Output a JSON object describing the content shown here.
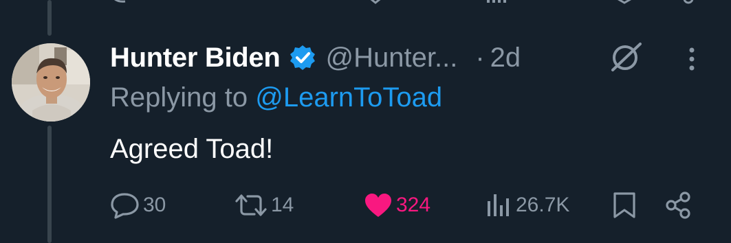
{
  "tweet": {
    "author_name": "Hunter Biden",
    "author_handle": "@Hunter...",
    "separator": "·",
    "timestamp": "2d",
    "replying_prefix": "Replying to",
    "replying_to": "@LearnToToad",
    "text": "Agreed Toad!"
  },
  "actions": {
    "replies": "30",
    "retweets": "14",
    "likes": "324",
    "views": "26.7K"
  },
  "colors": {
    "background": "#15202b",
    "muted_text": "#8b98a5",
    "accent_blue": "#1d9bf0",
    "like_pink": "#f91880",
    "thread_line": "#38444d"
  },
  "icons": [
    "verified-badge-icon",
    "grok-icon",
    "more-icon",
    "reply-icon",
    "retweet-icon",
    "like-icon",
    "views-icon",
    "bookmark-icon",
    "share-icon"
  ]
}
